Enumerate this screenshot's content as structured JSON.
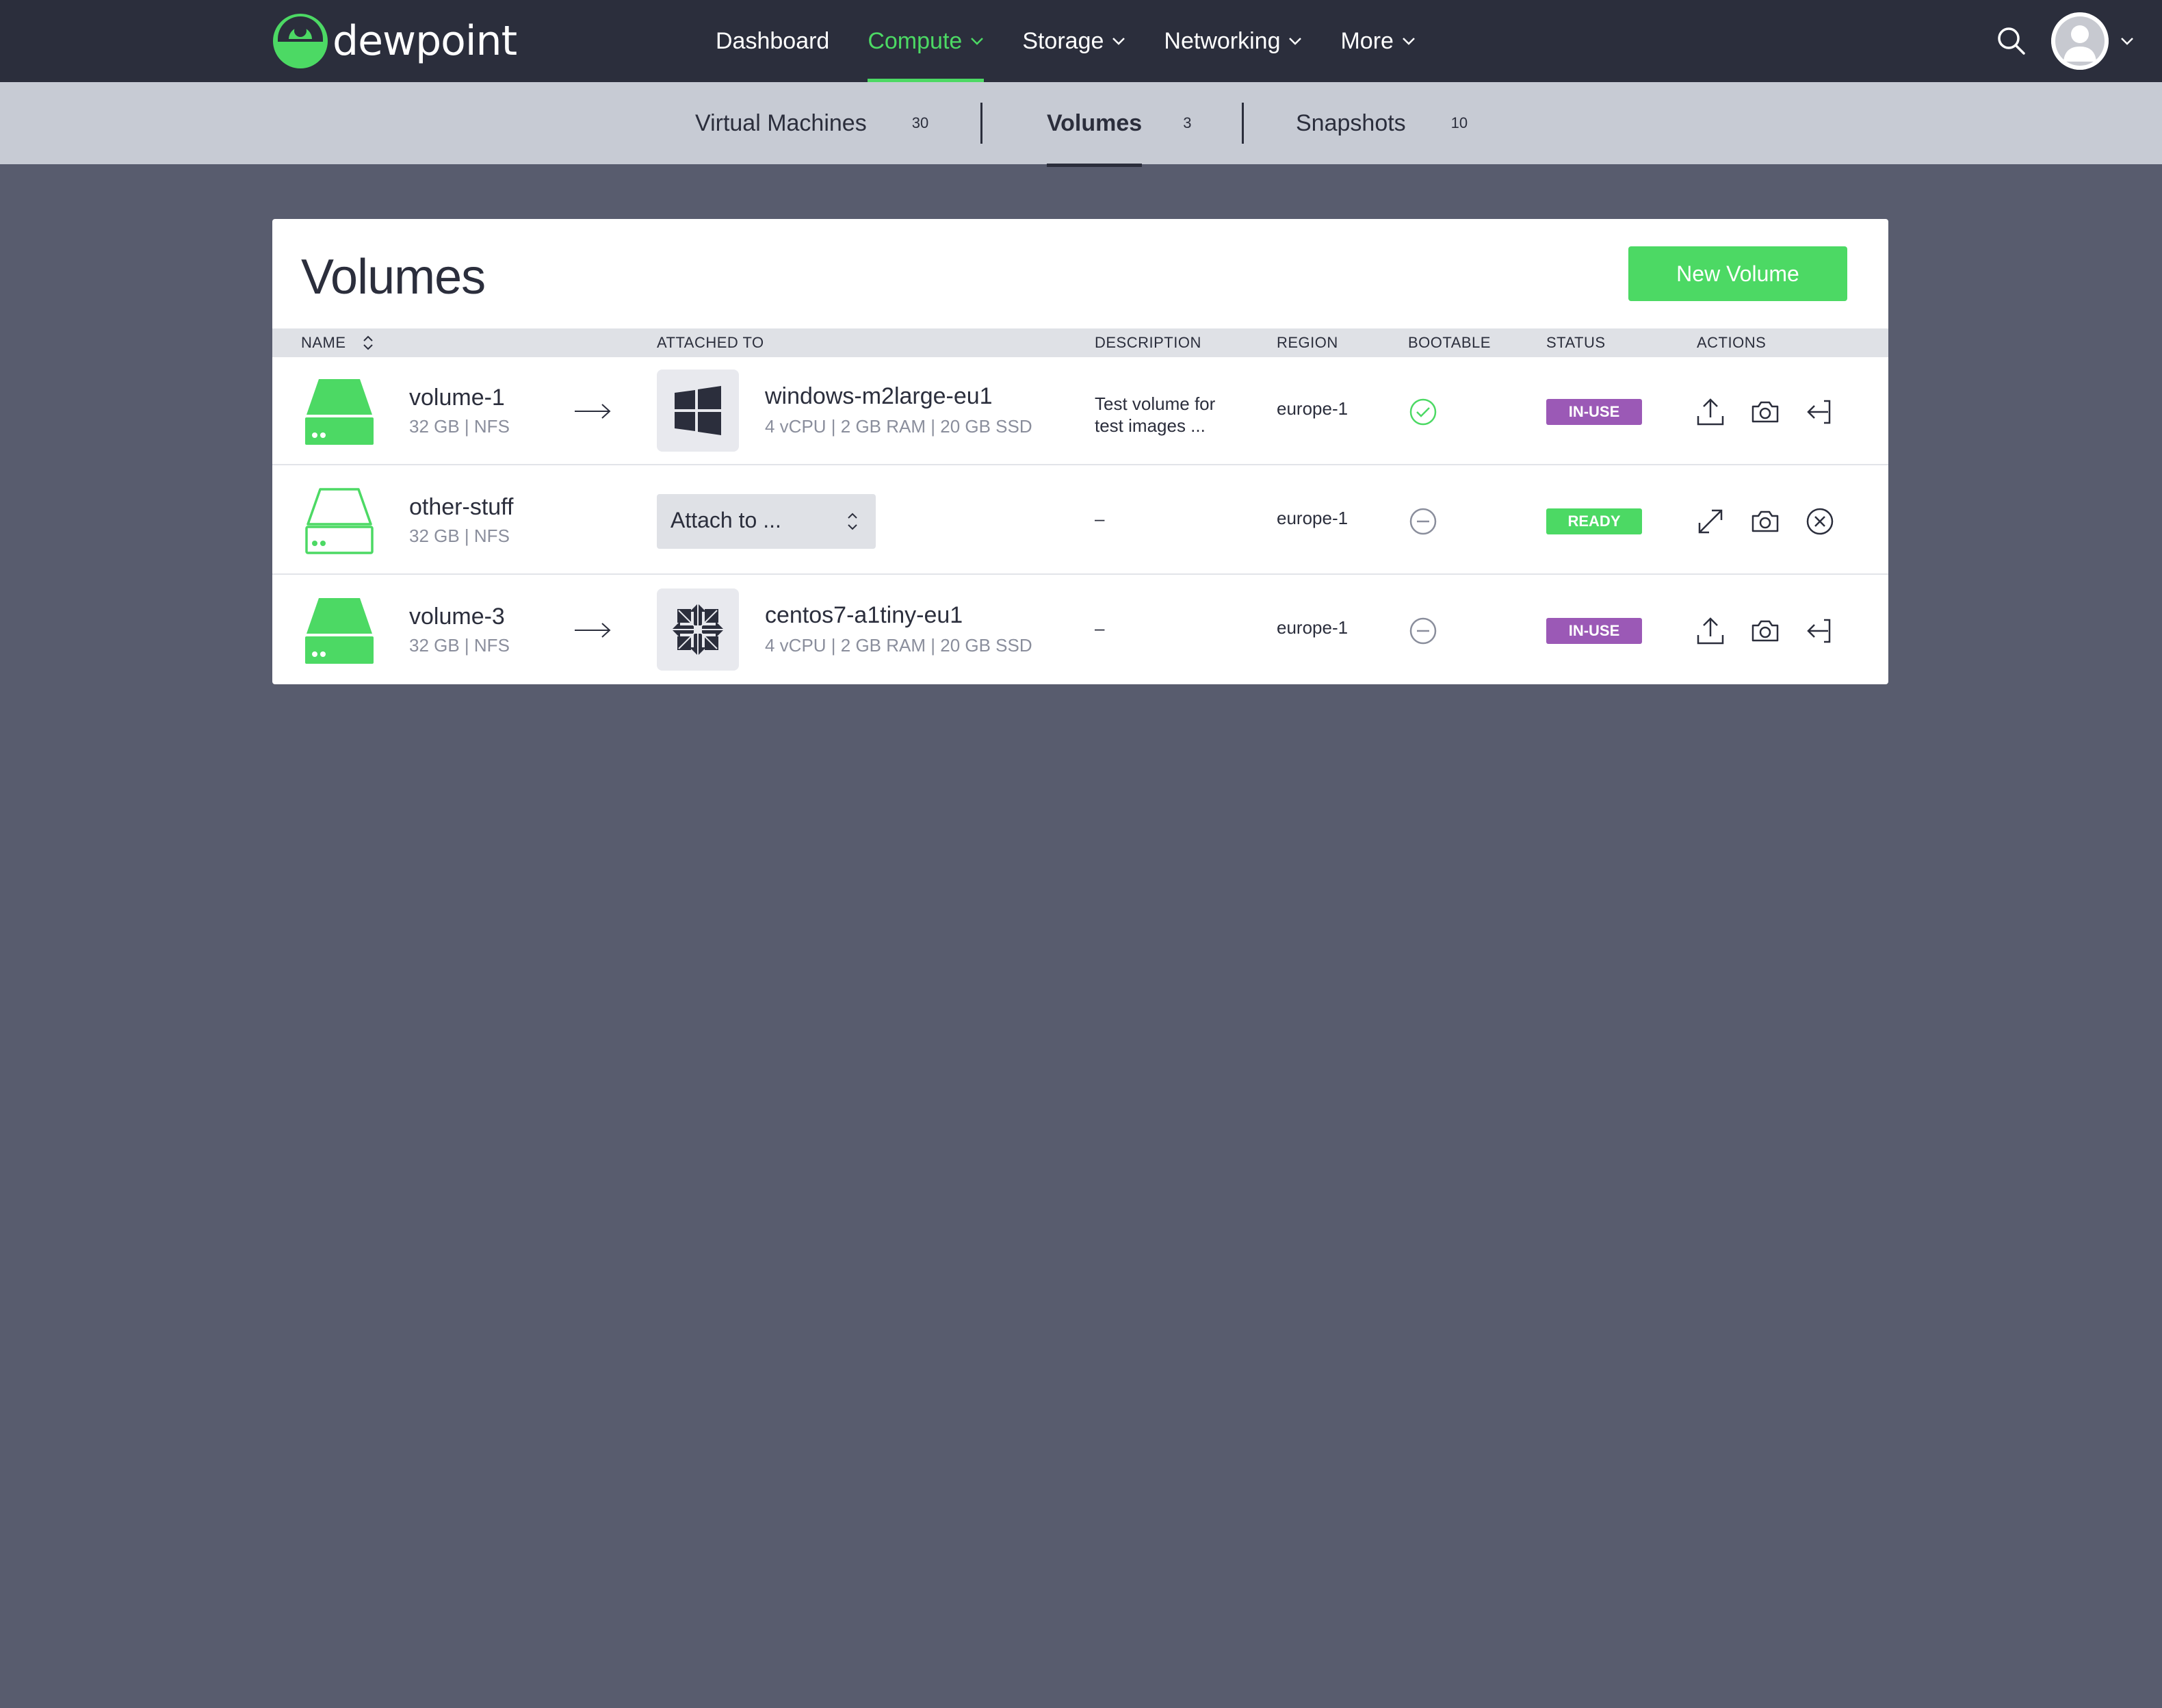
{
  "brand": {
    "name": "dewpoint",
    "accent": "#4cd964",
    "nav_bg": "#2b2e3c",
    "page_bg": "#585c6e"
  },
  "nav": [
    {
      "label": "Dashboard"
    },
    {
      "label": "Compute"
    },
    {
      "label": "Storage"
    },
    {
      "label": "Networking"
    },
    {
      "label": "More"
    }
  ],
  "subnav": [
    {
      "label": "Virtual Machines",
      "count": "30"
    },
    {
      "label": "Volumes",
      "count": "3"
    },
    {
      "label": "Snapshots",
      "count": "10"
    }
  ],
  "page": {
    "title": "Volumes",
    "new_button": "New Volume"
  },
  "table": {
    "headers": [
      "NAME",
      "ATTACHED TO",
      "DESCRIPTION",
      "REGION",
      "BOOTABLE",
      "STATUS",
      "ACTIONS"
    ],
    "rows": [
      {
        "name": "volume-1",
        "meta": "32 GB | NFS",
        "vm": "windows-m2large-eu1",
        "vm_specs": "4 vCPU | 2 GB RAM | 20 GB SSD",
        "description_1": "Test volume for",
        "description_2": "test images ...",
        "region": "europe-1",
        "bootable": "check-icon",
        "status": "IN-USE"
      },
      {
        "name": "other-stuff",
        "meta": "32 GB | NFS",
        "attach_placeholder": "Attach to ...",
        "description": "–",
        "region": "europe-1",
        "bootable": "minus-icon",
        "status": "READY"
      },
      {
        "name": "volume-3",
        "meta": "32 GB | NFS",
        "vm": "centos7-a1tiny-eu1",
        "vm_specs": "4 vCPU | 2 GB RAM | 20 GB SSD",
        "description": "–",
        "region": "europe-1",
        "bootable": "minus-icon",
        "status": "IN-USE"
      }
    ]
  },
  "status_colors": {
    "IN-USE": "#9b59b6",
    "READY": "#4cd964"
  }
}
